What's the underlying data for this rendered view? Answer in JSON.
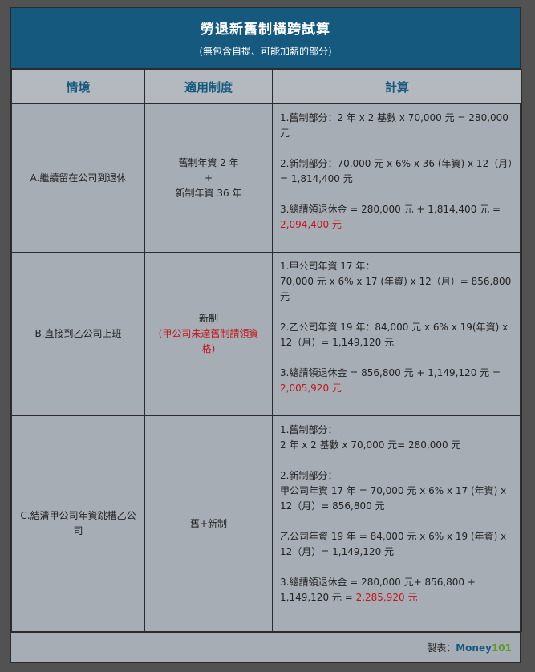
{
  "title": "勞退新舊制橫跨試算",
  "subtitle": "(無包含自提、可能加薪的部分)",
  "headers": [
    "情境",
    "適用制度",
    "計算"
  ],
  "rows": [
    {
      "scenario": "A.繼續留在公司到退休",
      "system": [
        "舊制年資 2 年",
        "+",
        "新制年資 36 年"
      ],
      "calc": {
        "p1": "1.舊制部分：2 年 x 2 基數 x 70,000 元 = 280,000 元",
        "p2": "2.新制部分：70,000 元 x 6% x 36 (年資) x 12（月）= 1,814,400 元",
        "p3_prefix": "3.總請領退休金 = 280,000 元 + 1,814,400 元 = ",
        "p3_total": "2,094,400 元"
      }
    },
    {
      "scenario": "B.直接到乙公司上班",
      "system_main": "新制",
      "system_note": "(甲公司未達舊制請領資格)",
      "calc": {
        "p1a": "1.甲公司年資 17 年：",
        "p1b": "70,000 元 x 6% x 17 (年資) x 12（月）= 856,800 元",
        "p2": "2.乙公司年資 19 年：84,000 元 x 6% x 19(年資) x 12（月）= 1,149,120 元",
        "p3_prefix": "3.總請領退休金 = 856,800 元 + 1,149,120 元 = ",
        "p3_total": "2,005,920 元"
      }
    },
    {
      "scenario": "C.結清甲公司年資跳槽乙公司",
      "system": "舊+新制",
      "calc": {
        "p1a": "1.舊制部分：",
        "p1b": "2 年 x 2 基數 x 70,000 元= 280,000 元",
        "p2a": "2.新制部分：",
        "p2b": "甲公司年資 17 年 = 70,000 元 x 6% x 17 (年資) x 12（月）= 856,800 元",
        "p2c": "乙公司年資 19 年 = 84,000 元 x 6% x 19 (年資) x 12（月）= 1,149,120 元",
        "p3_prefix": "3.總請領退休金 = 280,000 元+ 856,800 + 1,149,120 元 = ",
        "p3_total": "2,285,920 元"
      }
    }
  ],
  "footer": {
    "label": "製表：",
    "brand_name": "Money",
    "brand_number": "101"
  },
  "colors": {
    "header_bg": "#155a7e",
    "highlight": "#c0161c",
    "brand_green": "#5a9a2b"
  }
}
